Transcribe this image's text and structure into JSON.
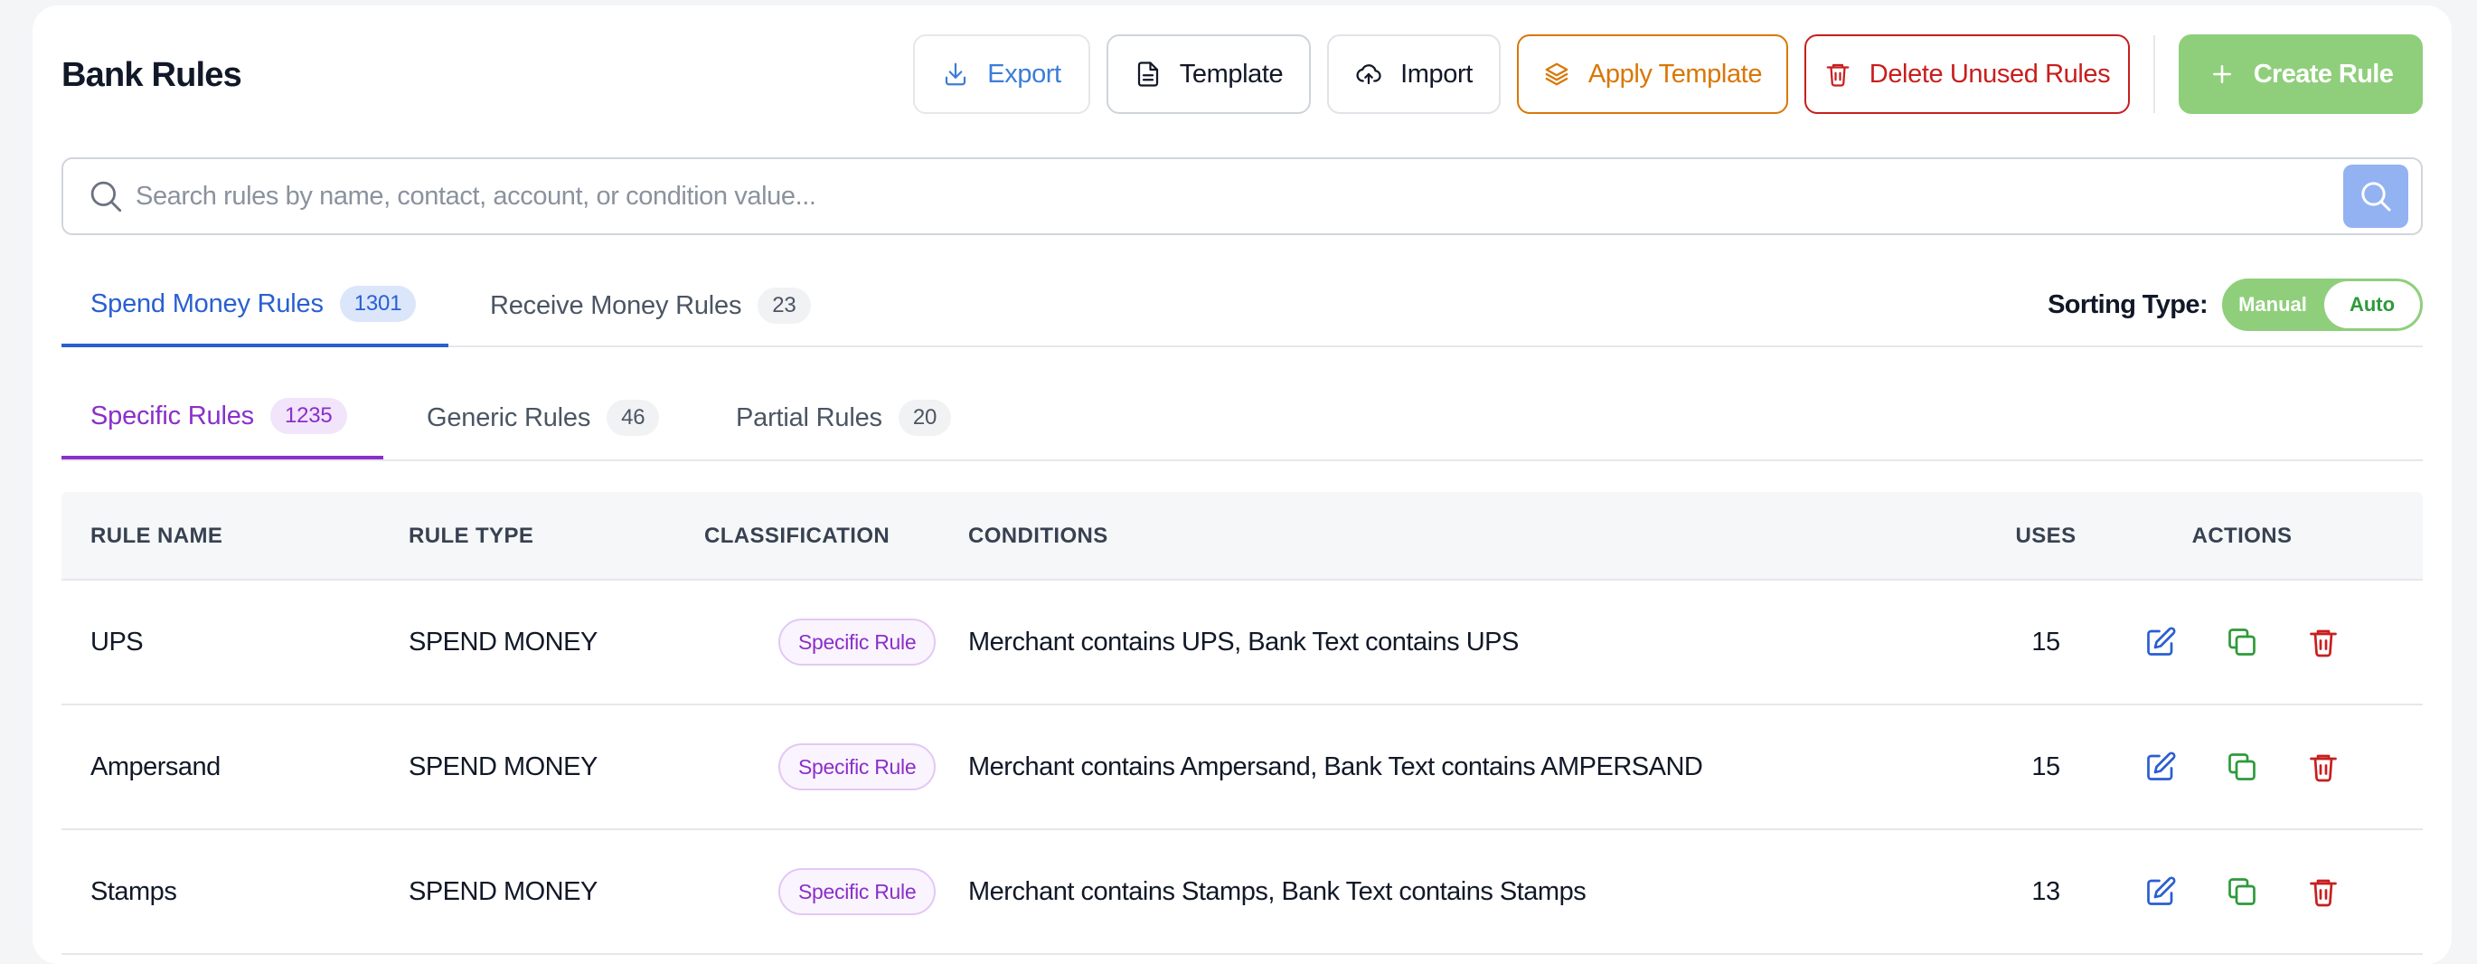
{
  "page": {
    "title": "Bank Rules"
  },
  "toolbar": {
    "export_label": "Export",
    "template_label": "Template",
    "import_label": "Import",
    "apply_template_label": "Apply Template",
    "delete_unused_label": "Delete Unused Rules",
    "create_rule_label": "Create Rule"
  },
  "search": {
    "placeholder": "Search rules by name, contact, account, or condition value...",
    "value": ""
  },
  "main_tabs": [
    {
      "label": "Spend Money Rules",
      "count": "1301",
      "active": true
    },
    {
      "label": "Receive Money Rules",
      "count": "23",
      "active": false
    }
  ],
  "sorting": {
    "label": "Sorting Type:",
    "options": [
      "Manual",
      "Auto"
    ],
    "selected": "Auto"
  },
  "sub_tabs": [
    {
      "label": "Specific Rules",
      "count": "1235",
      "active": true
    },
    {
      "label": "Generic Rules",
      "count": "46",
      "active": false
    },
    {
      "label": "Partial Rules",
      "count": "20",
      "active": false
    }
  ],
  "table": {
    "columns": [
      "RULE NAME",
      "RULE TYPE",
      "CLASSIFICATION",
      "CONDITIONS",
      "USES",
      "ACTIONS"
    ],
    "rows": [
      {
        "name": "UPS",
        "type": "SPEND MONEY",
        "classification": "Specific Rule",
        "conditions": "Merchant contains UPS, Bank Text contains UPS",
        "uses": "15"
      },
      {
        "name": "Ampersand",
        "type": "SPEND MONEY",
        "classification": "Specific Rule",
        "conditions": "Merchant contains Ampersand, Bank Text contains AMPERSAND",
        "uses": "15"
      },
      {
        "name": "Stamps",
        "type": "SPEND MONEY",
        "classification": "Specific Rule",
        "conditions": "Merchant contains Stamps, Bank Text contains Stamps",
        "uses": "13"
      }
    ]
  },
  "colors": {
    "primary_blue": "#2a5fd1",
    "specific_purple": "#8b2fc9",
    "create_green": "#8fcf7b",
    "apply_orange": "#d97706",
    "delete_red": "#c81e1e"
  },
  "icons": {
    "export": "download-icon",
    "template": "document-icon",
    "import": "cloud-upload-icon",
    "apply_template": "layers-icon",
    "delete_unused": "trash-icon",
    "create": "plus-icon",
    "search": "search-icon",
    "row_edit": "edit-icon",
    "row_copy": "copy-icon",
    "row_delete": "trash-icon"
  }
}
